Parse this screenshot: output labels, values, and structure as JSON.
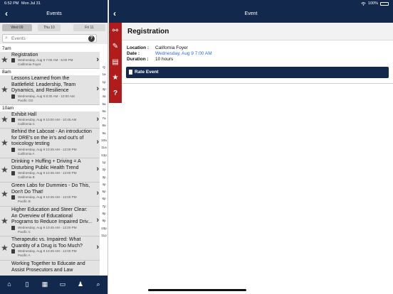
{
  "status": {
    "time": "6:52 PM",
    "date": "Mon Jul 31",
    "battery": "100%",
    "battery_level": 1.0
  },
  "left": {
    "title": "Events",
    "days": [
      {
        "label": "Wed 09",
        "selected": true
      },
      {
        "label": "Thu 10",
        "selected": false
      },
      {
        "label": "Fri 11",
        "selected": false
      }
    ],
    "search_placeholder": "Events",
    "help_label": "?",
    "back_label": "‹",
    "time_headers": [
      "7am",
      "8am",
      "10am"
    ],
    "events": [
      {
        "title": "Registration",
        "datetime": "Wednesday, Aug 9 7:00 AM - 5:00 PM",
        "location": "California Foyer"
      },
      {
        "title": "Lessons Learned from the Battlefield: Leadership, Team Dynamics, and Resilience",
        "datetime": "Wednesday, Aug 9 8:30 AM - 10:00 AM",
        "location": "Pacific CD"
      },
      {
        "title": "Exhibit Hall",
        "datetime": "Wednesday, Aug 9 10:00 AM - 10:45 AM",
        "location": "California C"
      },
      {
        "title": "Behind the Labcoat - An introduction for DRE's on the in's and out's of toxicology testing",
        "datetime": "Wednesday, Aug 9 10:45 AM - 12:00 PM",
        "location": "California A"
      },
      {
        "title": "Drinking + Huffing + Driving = A Disturbing Public Health Trend",
        "datetime": "Wednesday, Aug 9 10:45 AM - 12:00 PM",
        "location": "California B"
      },
      {
        "title": "Green Labs for Dummies - Do This, Don't Do That!",
        "datetime": "Wednesday, Aug 9 10:45 AM - 12:00 PM",
        "location": "Pacific B"
      },
      {
        "title": "Higher Education and Steer Clear: An Overview of Educational Programs to Reduce Impaired Driv...",
        "datetime": "Wednesday, Aug 9 10:45 AM - 12:00 PM",
        "location": "Pacific C"
      },
      {
        "title": "Therapeutic vs. Impaired: What Quantity of a Drug is Too Much?",
        "datetime": "Wednesday, Aug 9 10:45 AM - 12:00 PM",
        "location": "Pacific A"
      },
      {
        "title": "Working Together to Educate and Assist Prosecutors and Law",
        "datetime": "",
        "location": ""
      }
    ],
    "index_letters": [
      "Q",
      "1a",
      "1p",
      "3p",
      "4a",
      "5a",
      "6a",
      "7a",
      "8a",
      "9a",
      "10a",
      "11a",
      "12p",
      "1p",
      "2p",
      "3p",
      "4p",
      "5p",
      "6p",
      "7p",
      "8p",
      "9p",
      "10p",
      "11p"
    ],
    "tabs": [
      {
        "name": "home-tab-icon",
        "glyph": "⌂"
      },
      {
        "name": "device-tab-icon",
        "glyph": "▯"
      },
      {
        "name": "grid-tab-icon",
        "glyph": "▦"
      },
      {
        "name": "presentation-tab-icon",
        "glyph": "▭"
      },
      {
        "name": "person-tab-icon",
        "glyph": "♟"
      },
      {
        "name": "search-tab-icon",
        "glyph": "⌕"
      }
    ]
  },
  "right": {
    "title": "Event",
    "back_label": "‹",
    "rail_icons": [
      {
        "name": "share-icon",
        "glyph": "⚯"
      },
      {
        "name": "pencil-icon",
        "glyph": "✎"
      },
      {
        "name": "clipboard-icon",
        "glyph": "▤"
      },
      {
        "name": "star-icon",
        "glyph": "★"
      },
      {
        "name": "help-icon",
        "glyph": "?"
      }
    ],
    "heading": "Registration",
    "details": [
      {
        "key": "Location :",
        "value": "California Foyer",
        "link": false
      },
      {
        "key": "Date :",
        "value": "Wednesday, Aug 9 7:00 AM",
        "link": true
      },
      {
        "key": "Duration :",
        "value": "10 hours",
        "link": false
      }
    ],
    "rate_label": "Rate Event"
  },
  "colors": {
    "navy": "#12284c",
    "red": "#b01b1b",
    "link": "#2c6bd6",
    "row_bg": "#e3e3e3"
  }
}
